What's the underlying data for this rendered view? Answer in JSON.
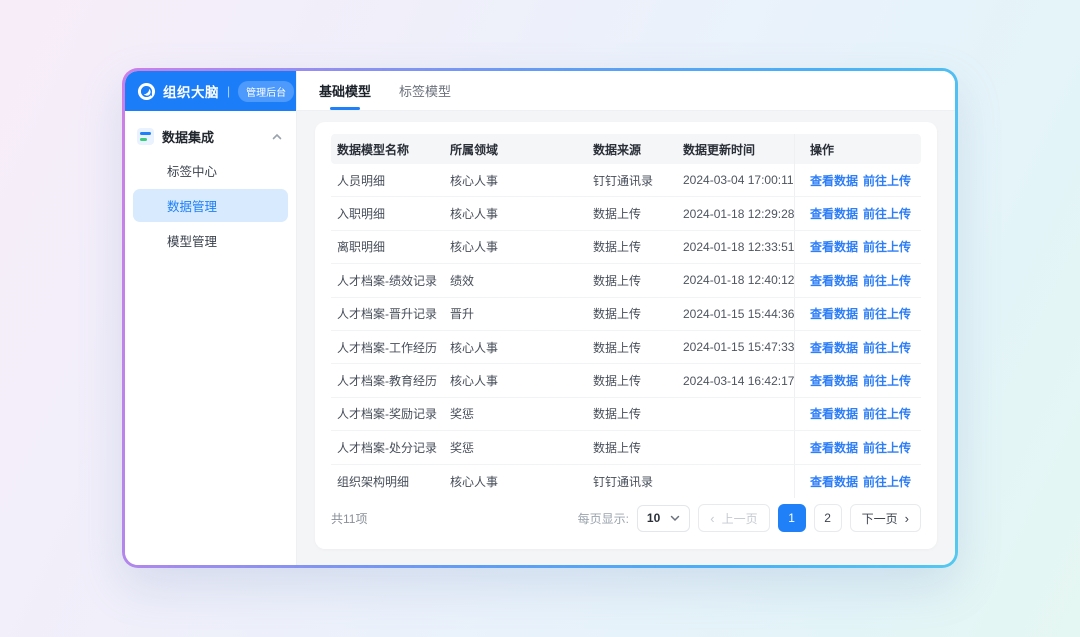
{
  "brand": {
    "name": "组织大脑",
    "separator": "|",
    "badge": "管理后台"
  },
  "sidebar": {
    "group": {
      "label": "数据集成"
    },
    "items": [
      {
        "label": "标签中心",
        "active": false
      },
      {
        "label": "数据管理",
        "active": true
      },
      {
        "label": "模型管理",
        "active": false
      }
    ]
  },
  "tabs": [
    {
      "label": "基础模型",
      "active": true
    },
    {
      "label": "标签模型",
      "active": false
    }
  ],
  "table": {
    "columns": [
      "数据模型名称",
      "所属领域",
      "数据来源",
      "数据更新时间",
      "操作"
    ],
    "action_links": [
      "查看数据",
      "前往上传"
    ],
    "rows": [
      {
        "name": "人员明细",
        "domain": "核心人事",
        "source": "钉钉通讯录",
        "updated": "2024-03-04 17:00:11"
      },
      {
        "name": "入职明细",
        "domain": "核心人事",
        "source": "数据上传",
        "updated": "2024-01-18 12:29:28"
      },
      {
        "name": "离职明细",
        "domain": "核心人事",
        "source": "数据上传",
        "updated": "2024-01-18 12:33:51"
      },
      {
        "name": "人才档案-绩效记录",
        "domain": "绩效",
        "source": "数据上传",
        "updated": "2024-01-18 12:40:12"
      },
      {
        "name": "人才档案-晋升记录",
        "domain": "晋升",
        "source": "数据上传",
        "updated": "2024-01-15 15:44:36"
      },
      {
        "name": "人才档案-工作经历",
        "domain": "核心人事",
        "source": "数据上传",
        "updated": "2024-01-15 15:47:33"
      },
      {
        "name": "人才档案-教育经历",
        "domain": "核心人事",
        "source": "数据上传",
        "updated": "2024-03-14 16:42:17"
      },
      {
        "name": "人才档案-奖励记录",
        "domain": "奖惩",
        "source": "数据上传",
        "updated": ""
      },
      {
        "name": "人才档案-处分记录",
        "domain": "奖惩",
        "source": "数据上传",
        "updated": ""
      },
      {
        "name": "组织架构明细",
        "domain": "核心人事",
        "source": "钉钉通讯录",
        "updated": ""
      }
    ]
  },
  "pagination": {
    "total_label": "共11项",
    "per_page_label": "每页显示:",
    "per_page_value": "10",
    "prev_label": "上一页",
    "next_label": "下一页",
    "pages": [
      "1",
      "2"
    ],
    "current_page": "1"
  },
  "colors": {
    "primary_blue": "#2080F7",
    "brandbar_blue": "#1B7DF8",
    "link_blue": "#2E7EF7",
    "active_item_bg": "#D8EAFD",
    "icon_green": "#3DCC7E"
  }
}
